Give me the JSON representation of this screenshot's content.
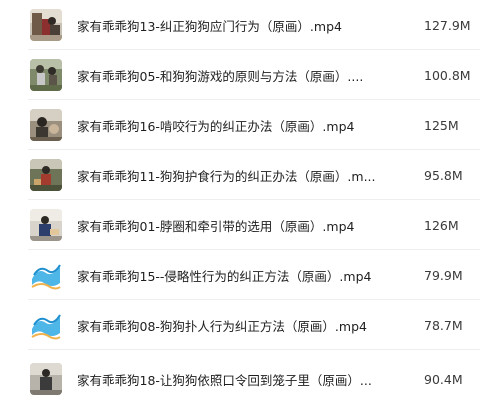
{
  "files": [
    {
      "name": "家有乖乖狗13-纠正狗狗应门行为（原画）.mp4",
      "size": "127.9M",
      "thumb_icon": "video-thumbnail-icon"
    },
    {
      "name": "家有乖乖狗05-和狗狗游戏的原则与方法（原画）....",
      "size": "100.8M",
      "thumb_icon": "video-thumbnail-icon"
    },
    {
      "name": "家有乖乖狗16-啃咬行为的纠正办法（原画）.mp4",
      "size": "125M",
      "thumb_icon": "video-thumbnail-icon"
    },
    {
      "name": "家有乖乖狗11-狗狗护食行为的纠正办法（原画）.m...",
      "size": "95.8M",
      "thumb_icon": "video-thumbnail-icon"
    },
    {
      "name": "家有乖乖狗01-脖圈和牵引带的选用（原画）.mp4",
      "size": "126M",
      "thumb_icon": "video-thumbnail-icon"
    },
    {
      "name": "家有乖乖狗15--侵略性行为的纠正方法（原画）.mp4",
      "size": "79.9M",
      "thumb_icon": "wave-thumbnail-icon"
    },
    {
      "name": "家有乖乖狗08-狗狗扑人行为纠正方法（原画）.mp4",
      "size": "78.7M",
      "thumb_icon": "wave-thumbnail-icon"
    },
    {
      "name": "家有乖乖狗18-让狗狗依照口令回到笼子里（原画）...",
      "size": "90.4M",
      "thumb_icon": "video-thumbnail-icon"
    }
  ]
}
